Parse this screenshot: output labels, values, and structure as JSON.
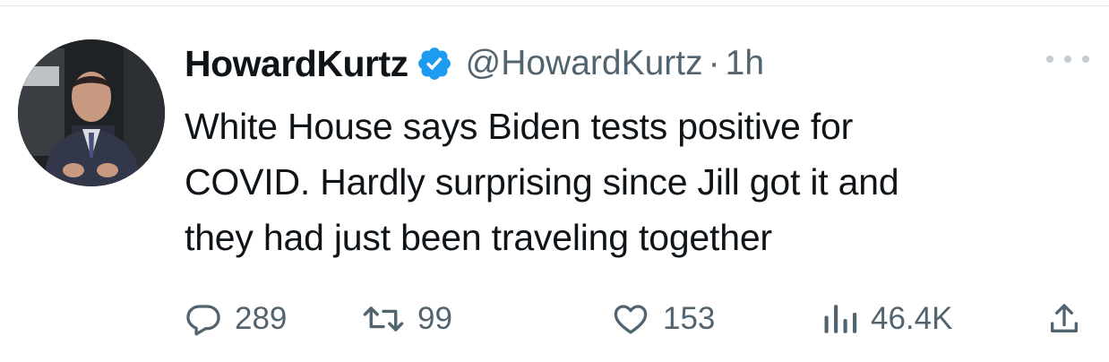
{
  "tweet": {
    "display_name": "HowardKurtz",
    "handle": "@HowardKurtz",
    "separator": "·",
    "time": "1h",
    "text_lines": [
      "White House says Biden tests positive for",
      "COVID. Hardly surprising since Jill got it and",
      "they had just been traveling together"
    ]
  },
  "actions": {
    "replies": "289",
    "retweets": "99",
    "likes": "153",
    "views": "46.4K"
  },
  "icons": {
    "reply": "speech-bubble-icon",
    "retweet": "retweet-arrows-icon",
    "like": "heart-icon",
    "views": "bar-chart-icon",
    "share": "share-upload-icon",
    "verified": "verified-badge-icon",
    "more": "ellipsis-icon"
  },
  "colors": {
    "verified_blue": "#1d9bf0",
    "text_primary": "#0f1419",
    "text_secondary": "#536471"
  }
}
